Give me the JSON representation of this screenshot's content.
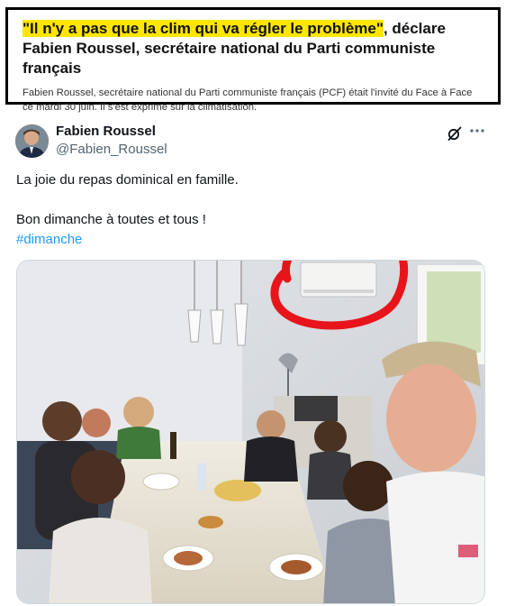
{
  "article": {
    "headline_highlight": "\"Il n'y a pas que la clim qui va régler le problème\"",
    "headline_rest": ", déclare Fabien Roussel, secrétaire national du Parti communiste français",
    "summary": "Fabien Roussel, secrétaire national du Parti communiste français (PCF) était l'invité du Face à Face ce mardi 30 juin. Il s'est exprimé sur la climatisation."
  },
  "tweet": {
    "author_name": "Fabien Roussel",
    "author_handle": "@Fabien_Roussel",
    "line1": "La joie du repas dominical en famille.",
    "line2": "Bon dimanche à toutes et tous !",
    "hashtag": "#dimanche",
    "icons": {
      "grok": "grok-icon",
      "more": "more-icon"
    },
    "photo": {
      "highlight_circle_color": "#e8141b"
    }
  }
}
